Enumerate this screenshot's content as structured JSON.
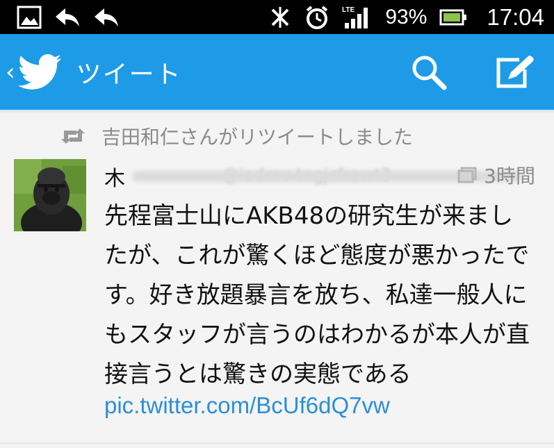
{
  "status_bar": {
    "battery": "93%",
    "time": "17:04",
    "network": "LTE",
    "icons": [
      "image-icon",
      "back-arrow-icon",
      "back-arrow-icon",
      "sync-off-icon",
      "alarm-icon",
      "signal-icon",
      "battery-icon"
    ]
  },
  "action_bar": {
    "back_glyph": "‹",
    "title": "ツイート",
    "icons": [
      "twitter-bird-icon",
      "search-icon",
      "compose-icon"
    ],
    "color": "#1e9be7"
  },
  "tweet": {
    "retweet_label": "吉田和仁さんがリツイートしました",
    "author_name": "木",
    "author_handle": "@iadmv tngjcfrawt3",
    "time": "3時間",
    "text": "先程富士山にAKB48の研究生が来ましたが、これが驚くほど態度が悪かったです。好き放題暴言を放ち、私達一般人にもスタッフが言うのはわかるが本人が直接言うとは驚きの実態である",
    "link": "pic.twitter.com/BcUf6dQ7vw",
    "link_color": "#2a8fd6"
  }
}
